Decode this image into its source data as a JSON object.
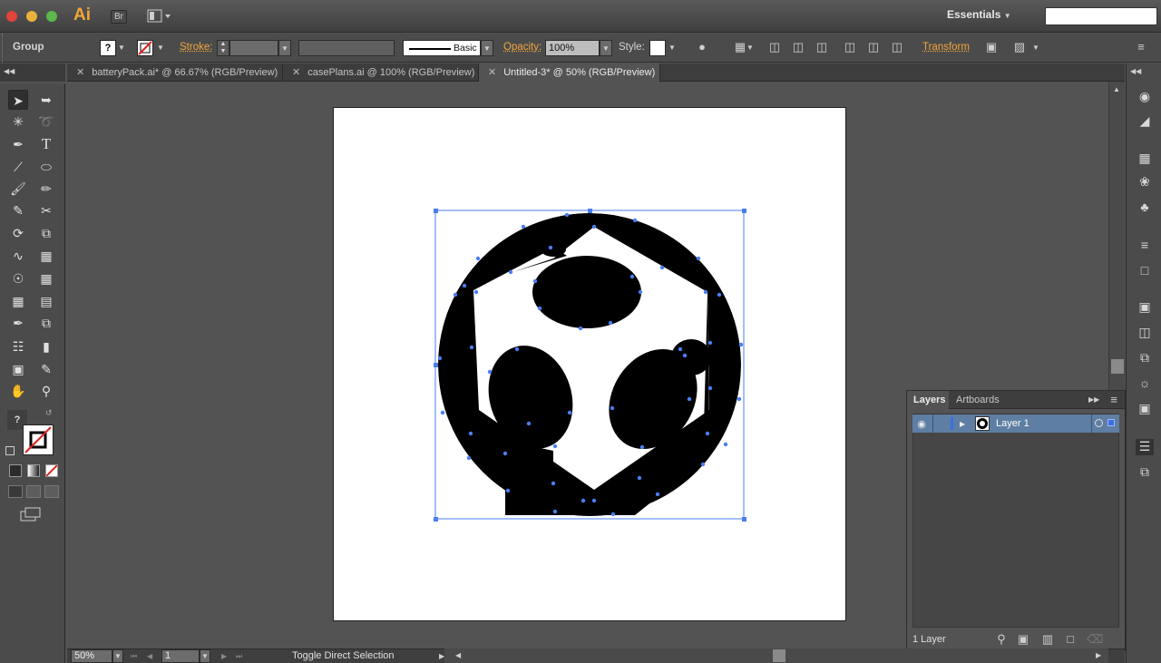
{
  "app": {
    "logo": "Ai",
    "bridge_button": "Br",
    "workspace": "Essentials",
    "search_placeholder": ""
  },
  "control": {
    "selection_type": "Group",
    "fill_value": "?",
    "stroke_label": "Stroke:",
    "brush_label": "Basic",
    "opacity_label": "Opacity:",
    "opacity_value": "100%",
    "style_label": "Style:",
    "transform_label": "Transform"
  },
  "tabs": [
    {
      "label": "batteryPack.ai* @ 66.67% (RGB/Preview)",
      "active": false
    },
    {
      "label": "casePlans.ai @ 100% (RGB/Preview)",
      "active": false
    },
    {
      "label": "Untitled-3* @ 50% (RGB/Preview)",
      "active": true
    }
  ],
  "tools": {
    "fill_question": "?"
  },
  "layers_panel": {
    "tabs": [
      "Layers",
      "Artboards"
    ],
    "layer_name": "Layer 1",
    "footer_count": "1 Layer"
  },
  "status": {
    "zoom": "50%",
    "artboard_number": "1",
    "status_text": "Toggle Direct Selection"
  },
  "colors": {
    "accent": "#f0a63a",
    "selection": "#4a7ef0",
    "background": "#535353"
  }
}
